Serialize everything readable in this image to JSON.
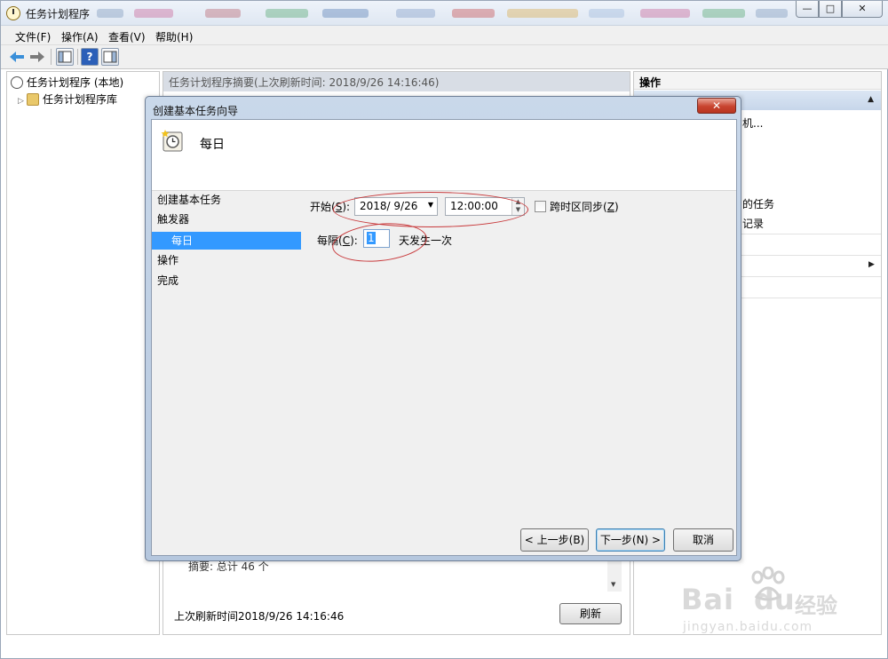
{
  "window": {
    "title": "任务计划程序",
    "controls": {
      "minimize": "—",
      "maximize": "□",
      "close": "✕"
    }
  },
  "menu": [
    "文件(F)",
    "操作(A)",
    "查看(V)",
    "帮助(H)"
  ],
  "tree": {
    "root": "任务计划程序 (本地)",
    "library": "任务计划程序库"
  },
  "center": {
    "header": "任务计划程序摘要(上次刷新时间: 2018/9/26 14:16:46)",
    "summary": "摘要: 总计 46 个",
    "last_refresh": "上次刷新时间2018/9/26 14:16:46",
    "refresh_button": "刷新"
  },
  "actions": {
    "header": "操作",
    "items": [
      "机...",
      "的任务",
      "记录"
    ]
  },
  "dialog": {
    "title": "创建基本任务向导",
    "close": "✕",
    "banner_title": "每日",
    "steps": [
      "创建基本任务",
      "触发器",
      "每日",
      "操作",
      "完成"
    ],
    "active_step": "每日",
    "start_label": "开始",
    "start_key": "S",
    "start_date": "2018/  9/26",
    "start_time": "12:00:00",
    "sync_label": "跨时区同步",
    "sync_key": "Z",
    "sync_checked": false,
    "interval_label": "每隔",
    "interval_key": "C",
    "interval_value": "1",
    "interval_suffix": "天发生一次",
    "buttons": {
      "back": "< 上一步(B)",
      "next": "下一步(N) >",
      "cancel": "取消"
    }
  },
  "watermark": {
    "brand": "Bai",
    "brand2": "du",
    "cn": "经验",
    "url": "jingyan.baidu.com"
  },
  "colors": {
    "selection": "#3399ff",
    "annotation": "#c8393b",
    "close_red": "#c8442f"
  }
}
